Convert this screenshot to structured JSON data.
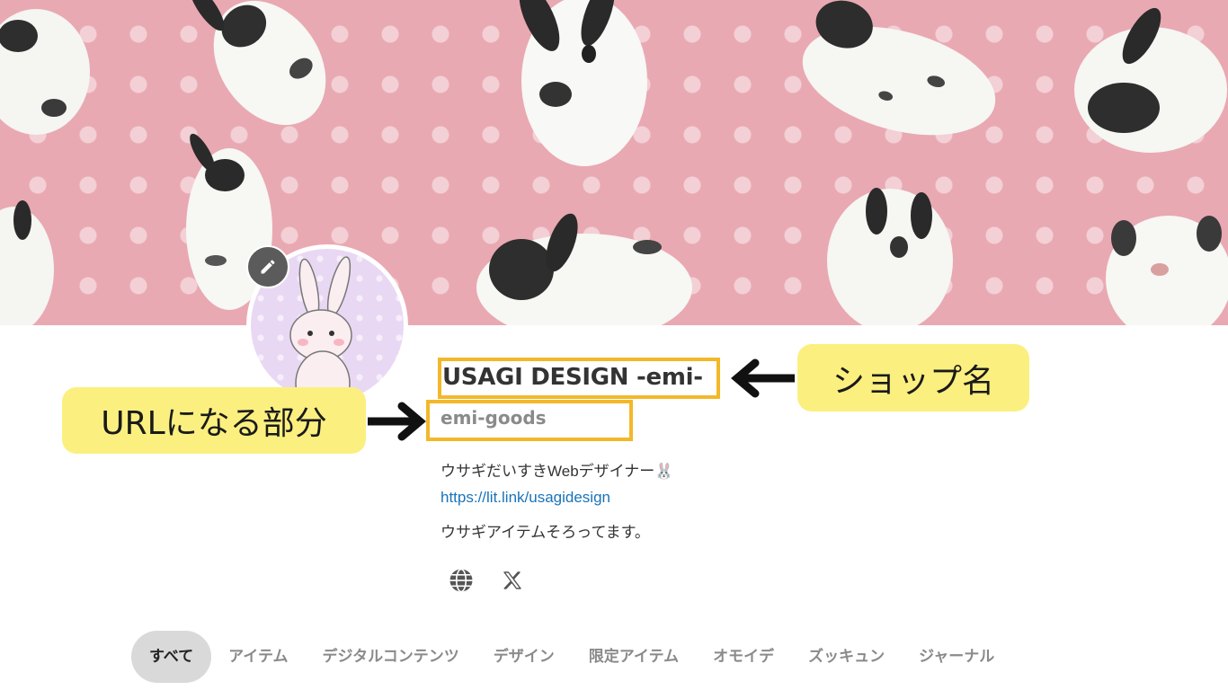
{
  "shop": {
    "name": "USAGI DESIGN -emi-",
    "url_id": "emi-goods",
    "description_line1": "ウサギだいすきWebデザイナー🐰",
    "link": "https://lit.link/usagidesign",
    "description_line3": "ウサギアイテムそろってます。"
  },
  "annotations": {
    "shop_name_label": "ショップ名",
    "url_label": "URLになる部分",
    "highlight_color": "#f3b829",
    "callout_color": "#fbf07f"
  },
  "social_icons": [
    "globe-icon",
    "x-logo-icon"
  ],
  "tabs": [
    {
      "label": "すべて",
      "active": true
    },
    {
      "label": "アイテム",
      "active": false
    },
    {
      "label": "デジタルコンテンツ",
      "active": false
    },
    {
      "label": "デザイン",
      "active": false
    },
    {
      "label": "限定アイテム",
      "active": false
    },
    {
      "label": "オモイデ",
      "active": false
    },
    {
      "label": "ズッキュン",
      "active": false
    },
    {
      "label": "ジャーナル",
      "active": false
    }
  ],
  "colors": {
    "banner_pink": "#e9a9b2",
    "link_blue": "#1a73b8",
    "edit_button": "#5b5b5b"
  }
}
